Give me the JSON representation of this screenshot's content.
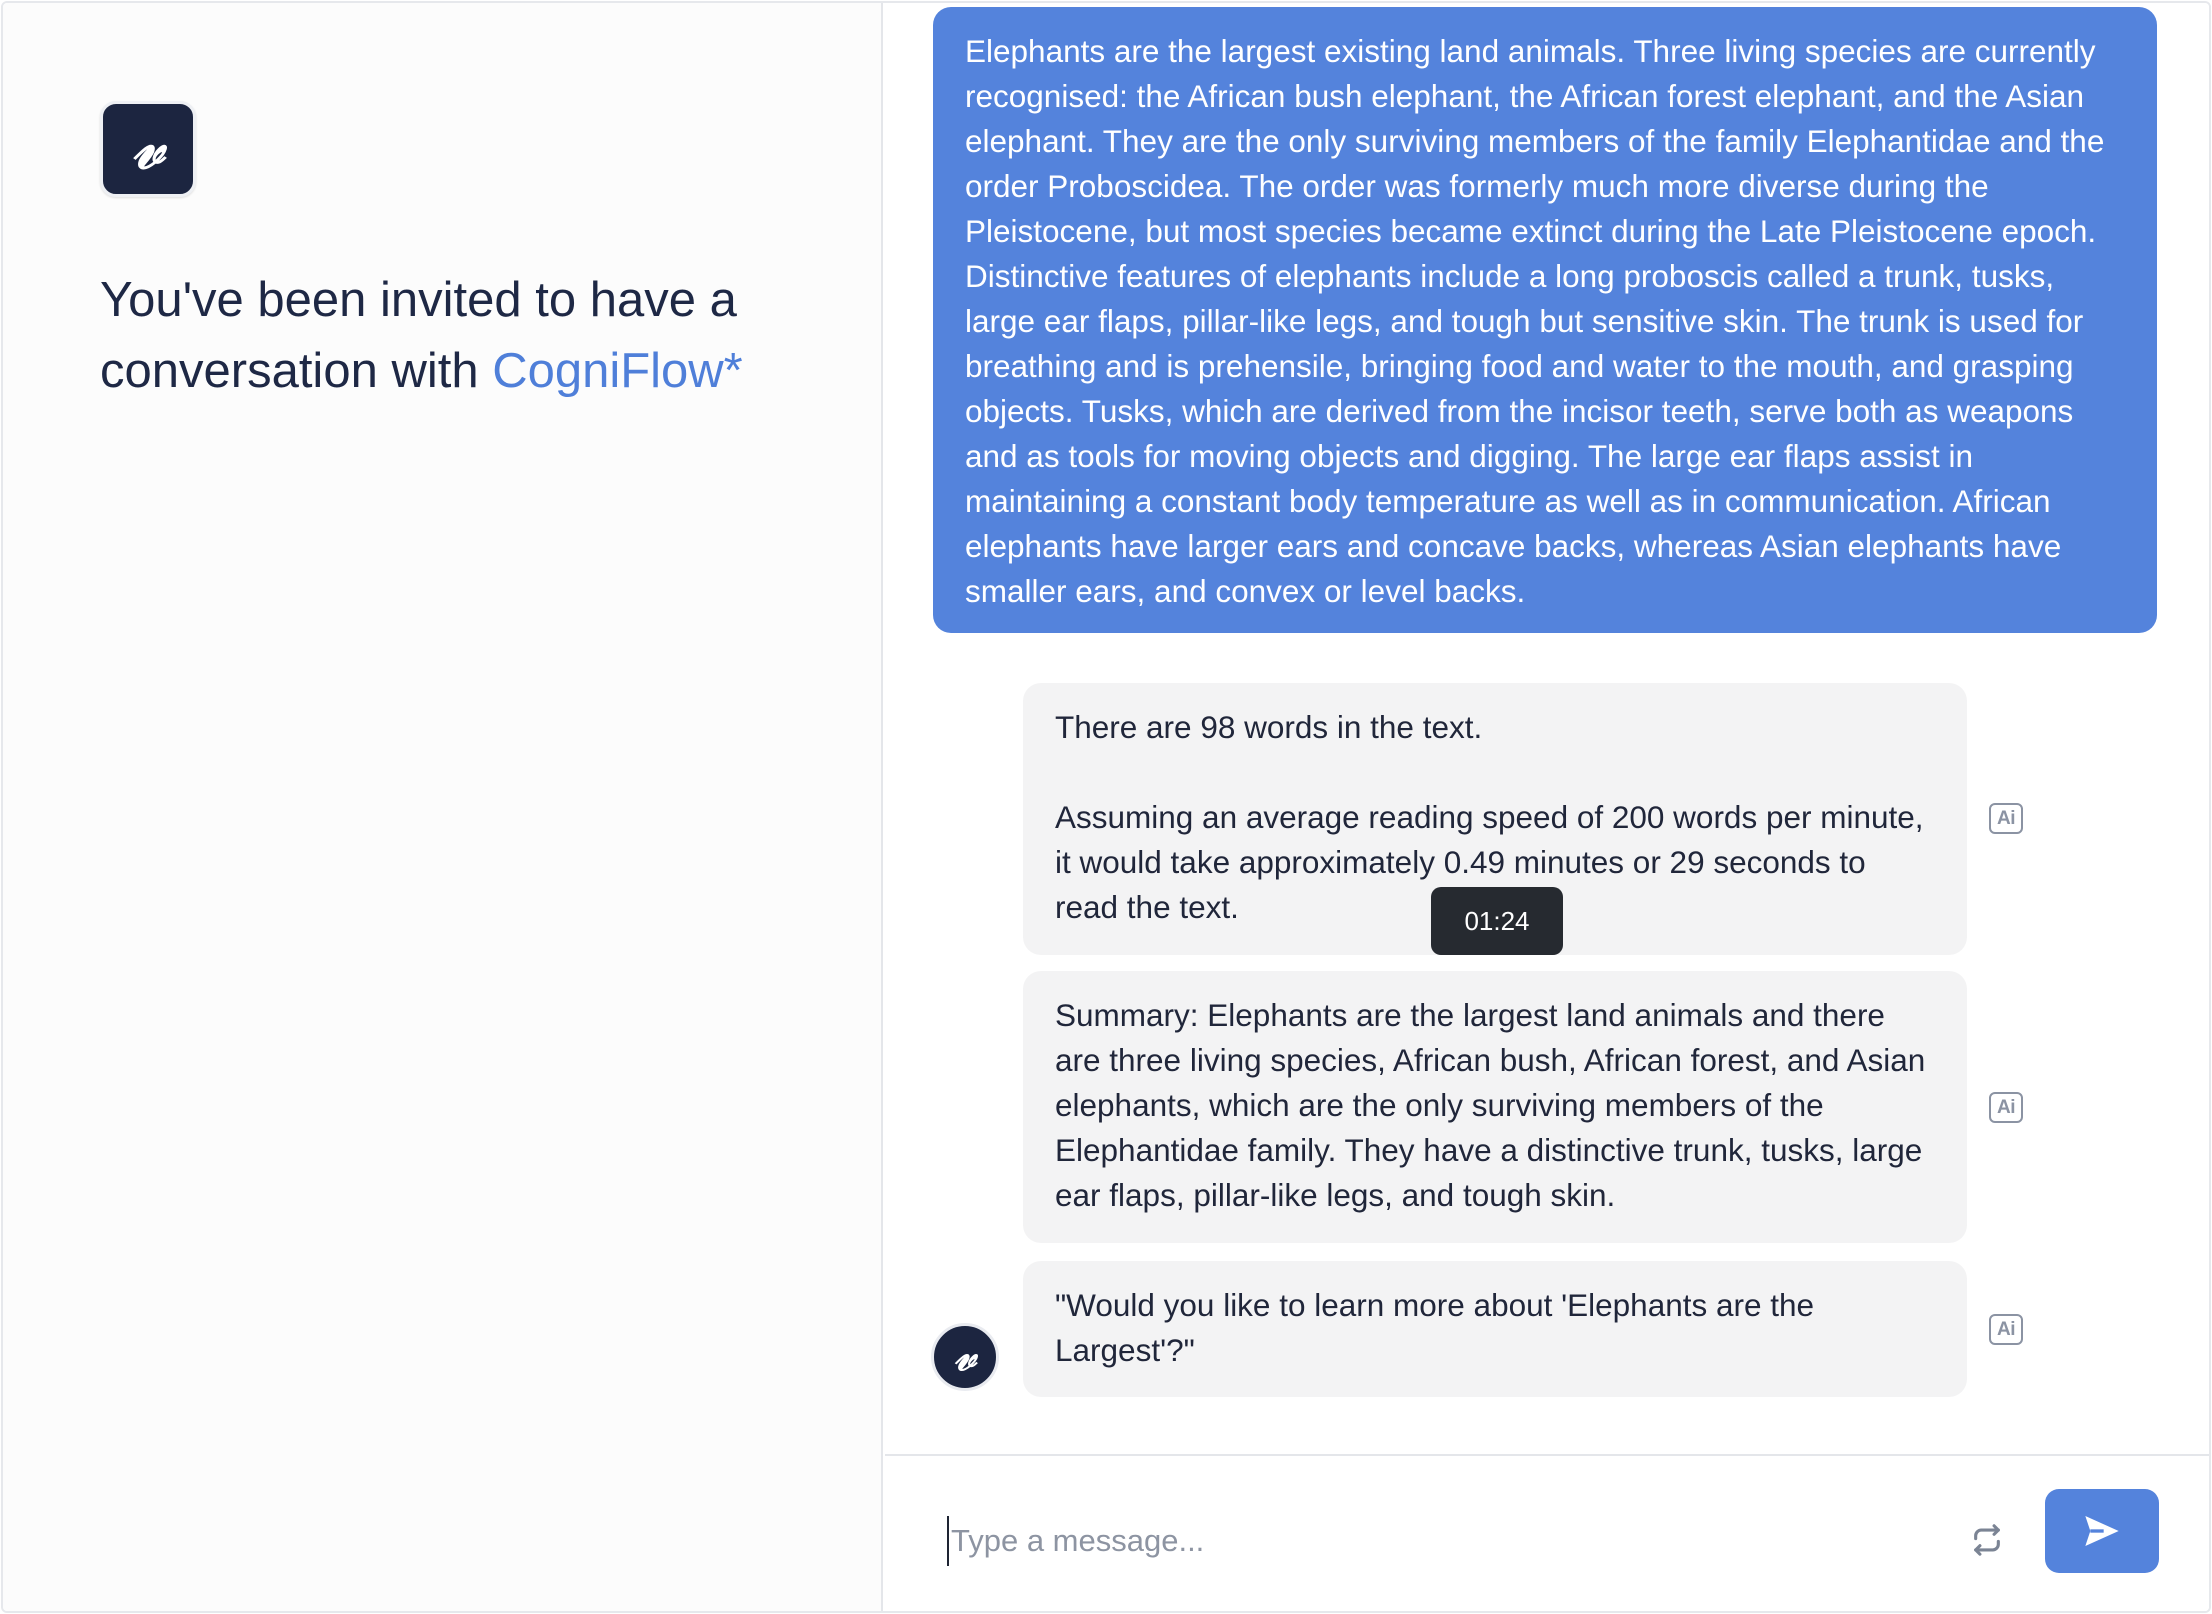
{
  "left_panel": {
    "logo_glyph": "𝓋",
    "invite_text": "You've been invited to have a conversation with",
    "brand_name": "CogniFlow*"
  },
  "conversation": {
    "user_message": "Elephants are the largest existing land animals. Three living species are currently recognised: the African bush elephant, the African forest elephant, and the Asian elephant. They are the only surviving members of the family Elephantidae and the order Proboscidea. The order was formerly much more diverse during the Pleistocene, but most species became extinct during the Late Pleistocene epoch. Distinctive features of elephants include a long proboscis called a trunk, tusks, large ear flaps, pillar-like legs, and tough but sensitive skin. The trunk is used for breathing and is prehensile, bringing food and water to the mouth, and grasping objects. Tusks, which are derived from the incisor teeth, serve both as weapons and as tools for moving objects and digging. The large ear flaps assist in maintaining a constant body temperature as well as in communication. African elephants have larger ears and concave backs, whereas Asian elephants have smaller ears, and convex or level backs.",
    "bot_messages": [
      {
        "paragraphs": [
          "There are 98 words in the text.",
          "Assuming an average reading speed of 200 words per minute, it would take approximately 0.49 minutes or 29 seconds to read the text."
        ]
      },
      {
        "paragraphs": [
          "Summary: Elephants are the largest land animals and there are three living species, African bush, African forest, and Asian elephants, which are the only surviving members of the Elephantidae family. They have a distinctive trunk, tusks, large ear flaps, pillar-like legs, and tough skin."
        ]
      },
      {
        "paragraphs": [
          "\"Would you like to learn more about 'Elephants are the Largest'?\""
        ]
      }
    ],
    "ai_badge_label": "Ai",
    "timestamp_tooltip": "01:24",
    "bot_avatar_glyph": "𝓋"
  },
  "composer": {
    "placeholder": "Type a message...",
    "value": "",
    "refresh_icon": "refresh-icon",
    "send_icon": "send-icon"
  },
  "colors": {
    "accent": "#5483dc",
    "brand_text": "#4f7fd9",
    "logo_bg": "#1c2540",
    "bot_bubble_bg": "#f3f3f4",
    "tooltip_bg": "#262a30"
  }
}
